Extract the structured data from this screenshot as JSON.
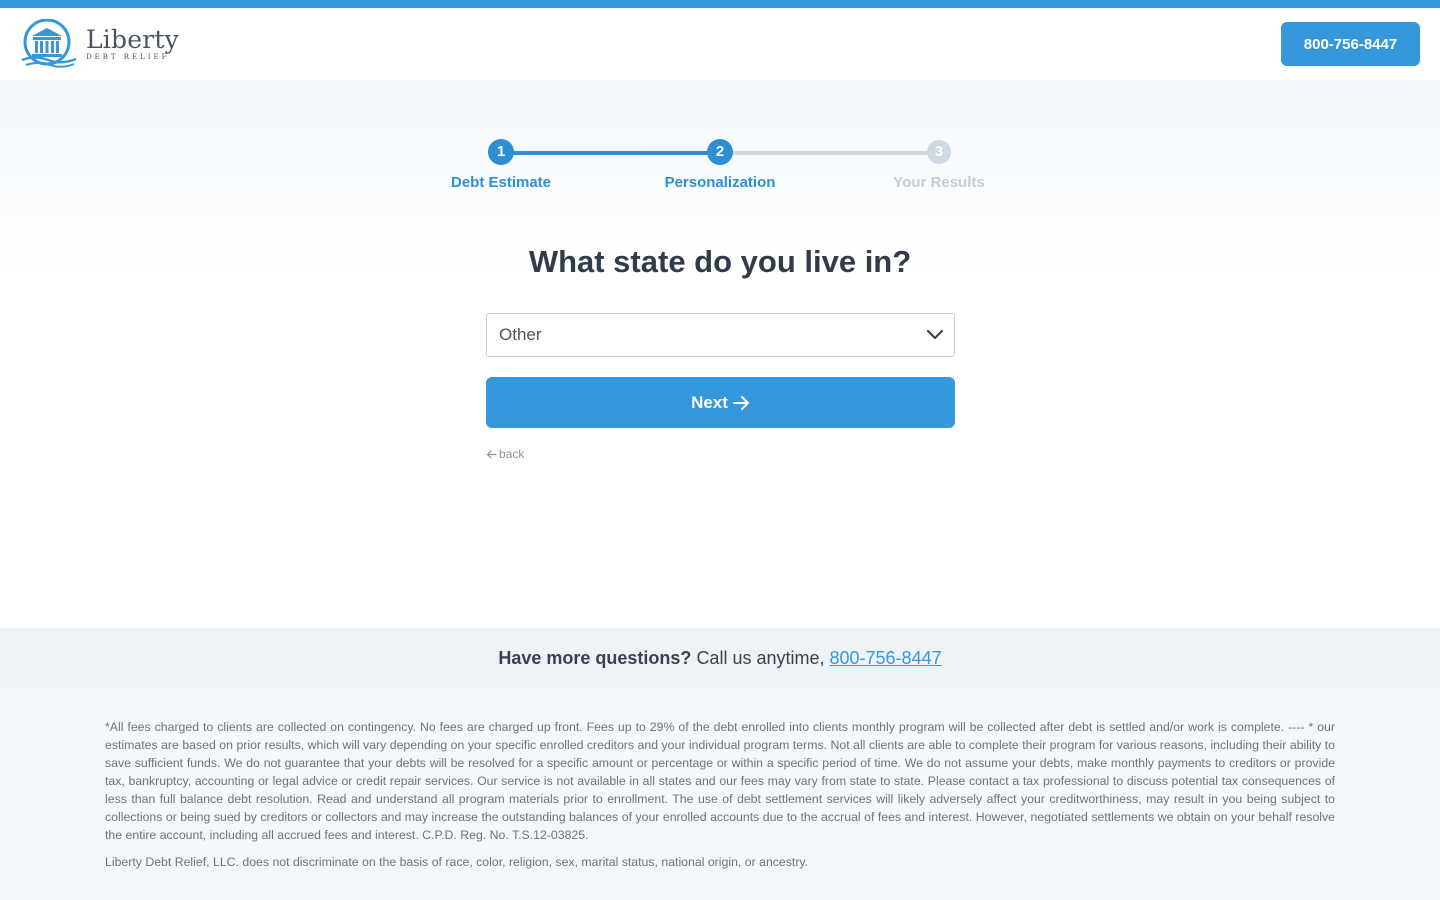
{
  "header": {
    "brand_name": "Liberty",
    "brand_sub": "DEBT RELIEF",
    "phone_button": "800-756-8447"
  },
  "stepper": {
    "steps": [
      {
        "number": "1",
        "label": "Debt Estimate",
        "state": "complete"
      },
      {
        "number": "2",
        "label": "Personalization",
        "state": "current"
      },
      {
        "number": "3",
        "label": "Your Results",
        "state": "pending"
      }
    ]
  },
  "main": {
    "question": "What state do you live in?",
    "state_select_value": "Other",
    "next_label": "Next",
    "back_label": "back"
  },
  "questions_band": {
    "bold": "Have more questions?",
    "text": "Call us anytime,",
    "phone": "800-756-8447"
  },
  "disclaimer": {
    "paragraph1": "*All fees charged to clients are collected on contingency. No fees are charged up front. Fees up to 29% of the debt enrolled into clients monthly program will be collected after debt is settled and/or work is complete. ---- * our estimates are based on prior results, which will vary depending on your specific enrolled creditors and your individual program terms. Not all clients are able to complete their program for various reasons, including their ability to save sufficient funds. We do not guarantee that your debts will be resolved for a specific amount or percentage or within a specific period of time. We do not assume your debts, make monthly payments to creditors or provide tax, bankruptcy, accounting or legal advice or credit repair services. Our service is not available in all states and our fees may vary from state to state. Please contact a tax professional to discuss potential tax consequences of less than full balance debt resolution. Read and understand all program materials prior to enrollment. The use of debt settlement services will likely adversely affect your creditworthiness, may result in you being subject to collections or being sued by creditors or collectors and may increase the outstanding balances of your enrolled accounts due to the accrual of fees and interest. However, negotiated settlements we obtain on your behalf resolve the entire account, including all accrued fees and interest. C.P.D. Reg. No. T.S.12-03825.",
    "paragraph2": "Liberty Debt Relief, LLC. does not discriminate on the basis of race, color, religion, sex, marital status, national origin, or ancestry."
  },
  "colors": {
    "accent": "#3498db",
    "step_active": "#2f8fd0",
    "step_pending": "#cfd8e3",
    "heading": "#323b4a"
  }
}
